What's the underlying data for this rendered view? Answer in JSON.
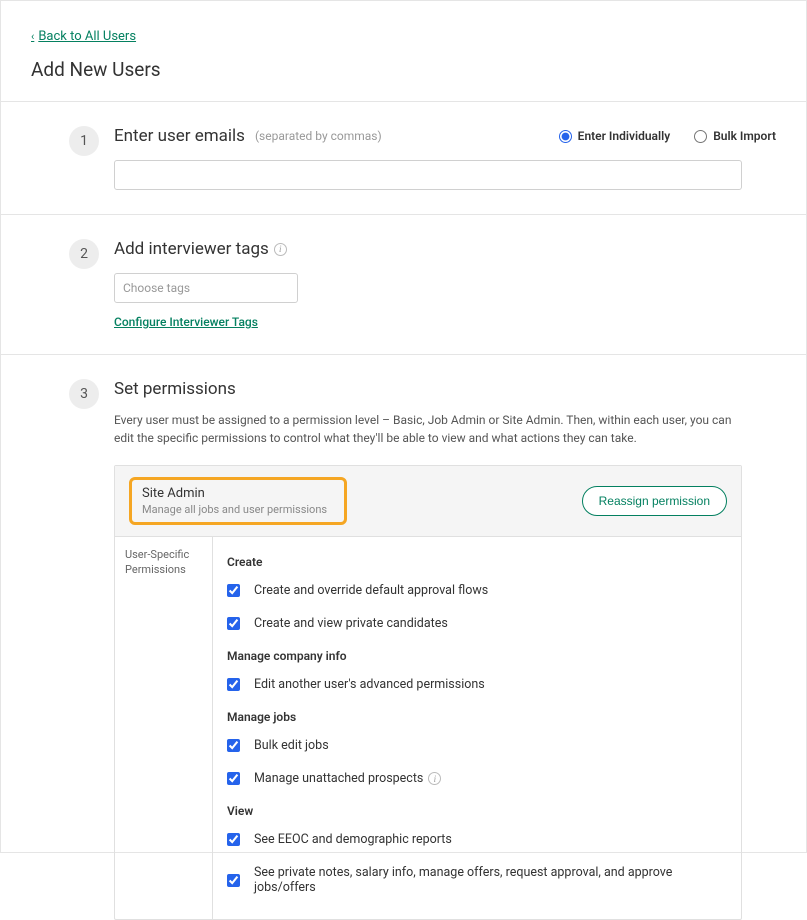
{
  "back_link": "Back to All Users",
  "page_title": "Add New Users",
  "steps": {
    "s1": {
      "number": "1",
      "title": "Enter user emails",
      "hint": "(separated by commas)",
      "radio_individual": "Enter Individually",
      "radio_bulk": "Bulk Import"
    },
    "s2": {
      "number": "2",
      "title": "Add interviewer tags",
      "tags_placeholder": "Choose tags",
      "configure_link": "Configure Interviewer Tags"
    },
    "s3": {
      "number": "3",
      "title": "Set permissions",
      "description": "Every user must be assigned to a permission level – Basic, Job Admin or Site Admin. Then, within each user, you can edit the specific permissions to control what they'll be able to view and what actions they can take.",
      "role_name": "Site Admin",
      "role_sub": "Manage all jobs and user permissions",
      "reassign_btn": "Reassign permission",
      "sidebar_label": "User-Specific Permissions",
      "groups": [
        {
          "title": "Create",
          "items": [
            "Create and override default approval flows",
            "Create and view private candidates"
          ]
        },
        {
          "title": "Manage company info",
          "items": [
            "Edit another user's advanced permissions"
          ]
        },
        {
          "title": "Manage jobs",
          "items": [
            "Bulk edit jobs",
            "Manage unattached prospects"
          ]
        },
        {
          "title": "View",
          "items": [
            "See EEOC and demographic reports",
            "See private notes, salary info, manage offers, request approval, and approve jobs/offers"
          ]
        }
      ]
    }
  }
}
